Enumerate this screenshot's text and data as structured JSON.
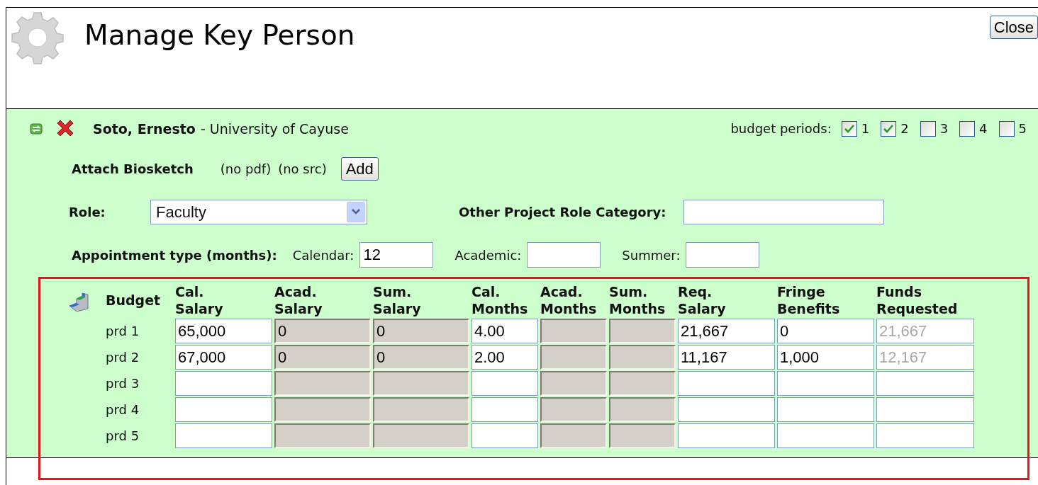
{
  "window": {
    "title": "Manage Key Person",
    "close_button": "Close"
  },
  "person": {
    "name": "Soto, Ernesto",
    "organization": "- University of Cayuse"
  },
  "budget_periods": {
    "label": "budget periods:",
    "periods": [
      {
        "label": "1",
        "checked": true
      },
      {
        "label": "2",
        "checked": true
      },
      {
        "label": "3",
        "checked": false
      },
      {
        "label": "4",
        "checked": false
      },
      {
        "label": "5",
        "checked": false
      }
    ]
  },
  "biosketch": {
    "label": "Attach Biosketch",
    "pdf": "(no pdf)",
    "src": "(no src)",
    "button": "Add"
  },
  "role": {
    "label": "Role:",
    "value": "Faculty"
  },
  "other_role": {
    "label": "Other Project Role Category:"
  },
  "appointment": {
    "label": "Appointment type (months):",
    "fields": [
      {
        "label": "Calendar:",
        "value": "12"
      },
      {
        "label": "Academic:"
      },
      {
        "label": "Summer:"
      }
    ]
  },
  "budget": {
    "title": "Budget",
    "columns": [
      {
        "label": "Cal. Salary",
        "kind": "editable"
      },
      {
        "label": "Acad. Salary",
        "kind": "disabled"
      },
      {
        "label": "Sum. Salary",
        "kind": "disabled"
      },
      {
        "label": "Cal. Months",
        "kind": "editable"
      },
      {
        "label": "Acad. Months",
        "kind": "disabled"
      },
      {
        "label": "Sum. Months",
        "kind": "disabled"
      },
      {
        "label": "Req. Salary",
        "kind": "editable"
      },
      {
        "label": "Fringe Benefits",
        "kind": "editable"
      },
      {
        "label": "Funds Requested",
        "kind": "readonly"
      }
    ],
    "rows": [
      {
        "label": "prd 1",
        "cells": [
          "65,000",
          "0",
          "0",
          "4.00",
          null,
          null,
          "21,667",
          "0",
          "21,667"
        ]
      },
      {
        "label": "prd 2",
        "cells": [
          "67,000",
          "0",
          "0",
          "2.00",
          null,
          null,
          "11,167",
          "1,000",
          "12,167"
        ]
      },
      {
        "label": "prd 3"
      },
      {
        "label": "prd 4"
      },
      {
        "label": "prd 5"
      }
    ]
  }
}
